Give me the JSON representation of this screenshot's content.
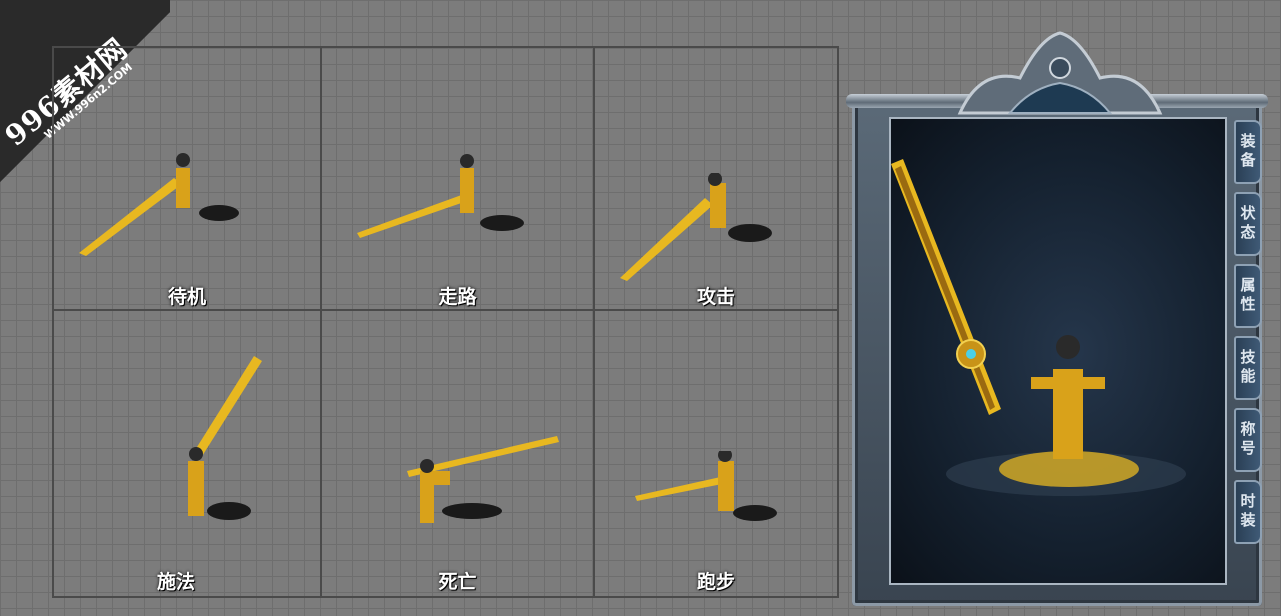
{
  "watermark": {
    "big": "996素材网",
    "small": "WWW.996n2.COM"
  },
  "actions": [
    {
      "label": "待机"
    },
    {
      "label": "走路"
    },
    {
      "label": "攻击"
    },
    {
      "label": "施法"
    },
    {
      "label": "死亡"
    },
    {
      "label": "跑步"
    }
  ],
  "tabs": [
    {
      "label": "装备"
    },
    {
      "label": "状态"
    },
    {
      "label": "属性"
    },
    {
      "label": "技能"
    },
    {
      "label": "称号"
    },
    {
      "label": "时装"
    }
  ],
  "colors": {
    "gold": "#e8b820",
    "shadow": "#1a1a1a",
    "frame": "#8c99a6",
    "viewport": "#14202e"
  }
}
